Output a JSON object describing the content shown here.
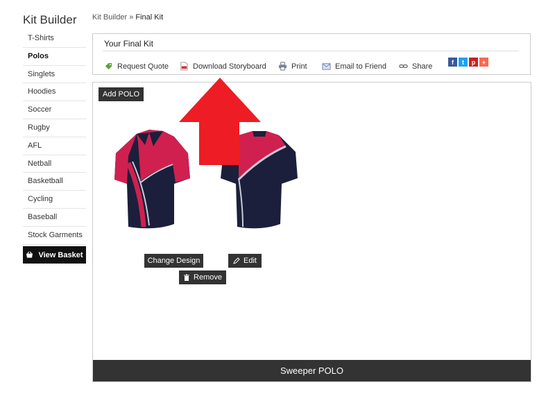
{
  "sidebar": {
    "title": "Kit Builder",
    "items": [
      {
        "label": "T-Shirts"
      },
      {
        "label": "Polos",
        "active": true
      },
      {
        "label": "Singlets"
      },
      {
        "label": "Hoodies"
      },
      {
        "label": "Soccer"
      },
      {
        "label": "Rugby"
      },
      {
        "label": "AFL"
      },
      {
        "label": "Netball"
      },
      {
        "label": "Basketball"
      },
      {
        "label": "Cycling"
      },
      {
        "label": "Baseball"
      },
      {
        "label": "Stock Garments"
      }
    ],
    "basket_label": "View Basket"
  },
  "breadcrumb": {
    "root": "Kit Builder",
    "separator": "»",
    "current": "Final Kit"
  },
  "final_kit": {
    "title": "Your Final Kit",
    "actions": {
      "request_quote": "Request Quote",
      "download_storyboard": "Download Storyboard",
      "print": "Print",
      "email": "Email to Friend",
      "share": "Share"
    },
    "social": [
      "f",
      "t",
      "p",
      "+"
    ]
  },
  "kit": {
    "add_label": "Add POLO",
    "change_design_label": "Change Design",
    "edit_label": "Edit",
    "remove_label": "Remove",
    "design_name": "Sweeper POLO"
  },
  "colors": {
    "navy": "#1b1f3b",
    "pink": "#d0204f",
    "dark_button": "#333333",
    "arrow_red": "#ee1c24",
    "facebook": "#3b5998",
    "twitter": "#1da1f2",
    "pinterest": "#cb2027",
    "addthis": "#f8694d"
  }
}
